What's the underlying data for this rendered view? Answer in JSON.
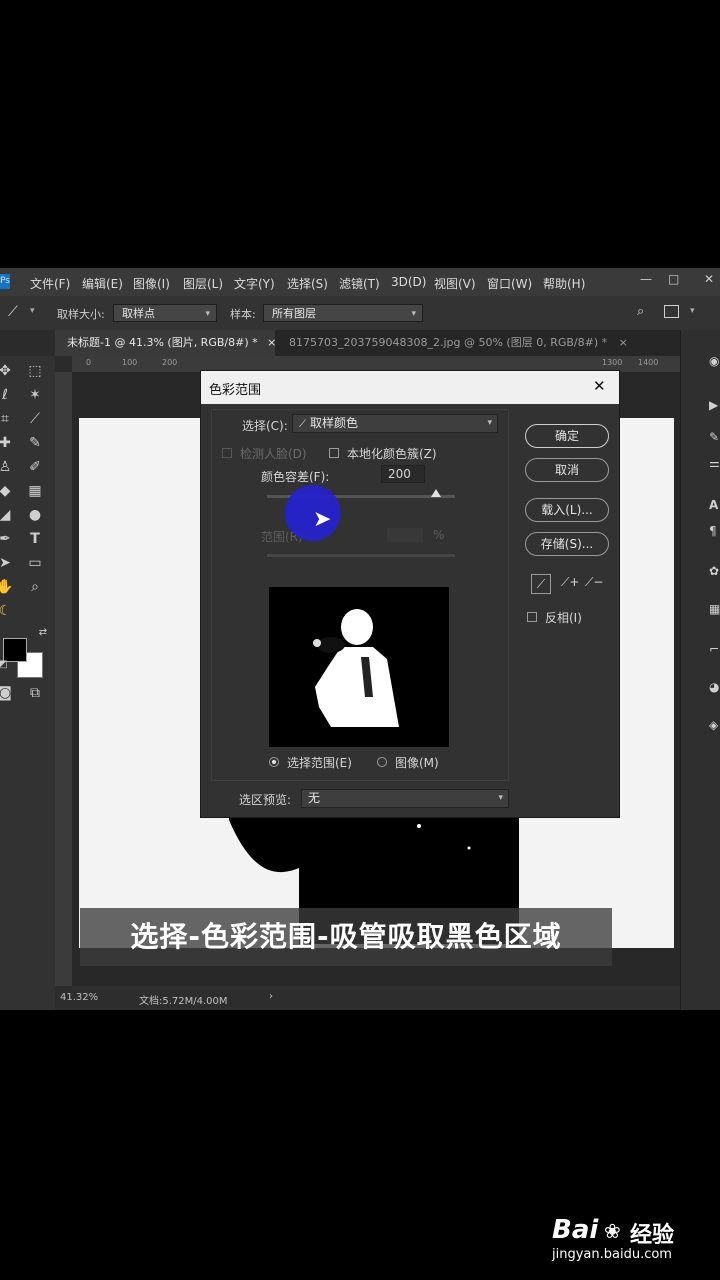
{
  "menubar": {
    "logo": "Ps",
    "items": [
      "文件(F)",
      "编辑(E)",
      "图像(I)",
      "图层(L)",
      "文字(Y)",
      "选择(S)",
      "滤镜(T)",
      "3D(D)",
      "视图(V)",
      "窗口(W)",
      "帮助(H)"
    ],
    "minimize": "—",
    "maximize": "□",
    "close": "✕"
  },
  "options_bar": {
    "sample_size_label": "取样大小:",
    "sample_size_value": "取样点",
    "sample_label": "样本:",
    "sample_value": "所有图层"
  },
  "tabs": [
    {
      "label": "未标题-1 @ 41.3% (图片, RGB/8#) *",
      "close": "×"
    },
    {
      "label": "8175703_203759048308_2.jpg @ 50% (图层 0, RGB/8#) *",
      "close": "×"
    }
  ],
  "ruler_h_ticks": [
    "0",
    "100",
    "200",
    "1300",
    "1400"
  ],
  "status": {
    "zoom": "41.32%",
    "doc": "文档:5.72M/4.00M",
    "arrow": "›"
  },
  "dialog": {
    "title": "色彩范围",
    "close": "✕",
    "select_label": "选择(C):",
    "select_value": "取样颜色",
    "detect_faces": "检测人脸(D)",
    "localized": "本地化颜色簇(Z)",
    "fuzziness_label": "颜色容差(F):",
    "fuzziness_value": "200",
    "fuzziness_fraction": 0.9,
    "range_label": "范围(R)",
    "range_unit": "%",
    "radio_selection": "选择范围(E)",
    "radio_image": "图像(M)",
    "preview_label": "选区预览:",
    "preview_value": "无",
    "btn_ok": "确定",
    "btn_cancel": "取消",
    "btn_load": "载入(L)...",
    "btn_save": "存储(S)...",
    "invert": "反相(I)"
  },
  "caption": "选择-色彩范围-吸管吸取黑色区域",
  "watermark": {
    "brand_left": "Bai",
    "brand_right": "经验",
    "url": "jingyan.baidu.com"
  }
}
